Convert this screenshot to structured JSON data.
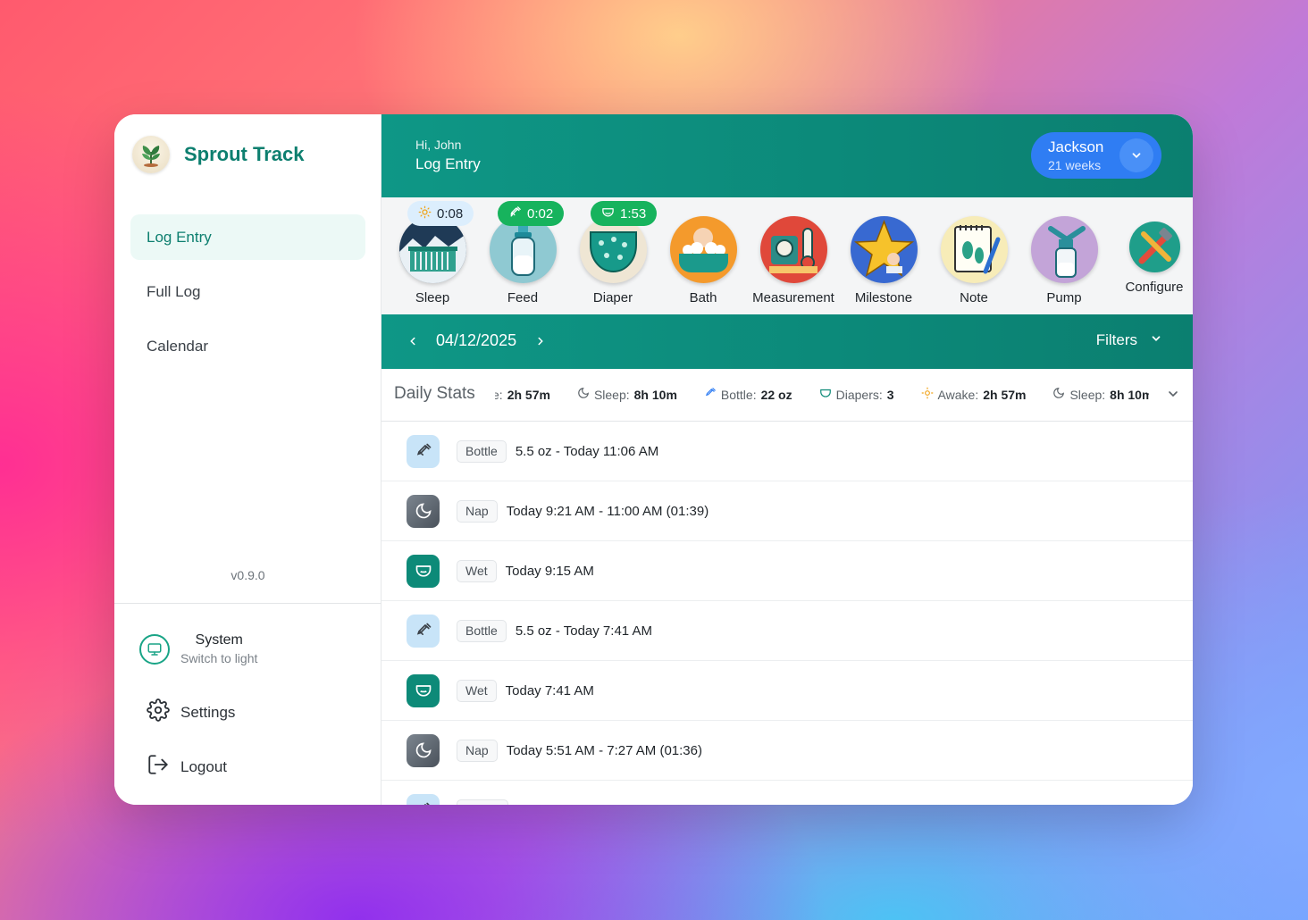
{
  "app": {
    "name": "Sprout Track",
    "version": "v0.9.0"
  },
  "nav": {
    "items": [
      {
        "label": "Log Entry",
        "active": true
      },
      {
        "label": "Full Log",
        "active": false
      },
      {
        "label": "Calendar",
        "active": false
      }
    ]
  },
  "theme": {
    "title": "System",
    "subtitle": "Switch to light",
    "icon": "monitor-icon"
  },
  "sidebar_links": {
    "settings": "Settings",
    "logout": "Logout"
  },
  "header": {
    "greeting": "Hi, John",
    "title": "Log Entry"
  },
  "child": {
    "name": "Jackson",
    "age": "21 weeks"
  },
  "timers": {
    "sleep": "0:08",
    "feed": "0:02",
    "diaper": "1:53"
  },
  "actions": [
    {
      "label": "Sleep",
      "icon": "sleep-crib-icon"
    },
    {
      "label": "Feed",
      "icon": "baby-bottle-icon"
    },
    {
      "label": "Diaper",
      "icon": "diaper-icon"
    },
    {
      "label": "Bath",
      "icon": "bathtub-icon"
    },
    {
      "label": "Measurement",
      "icon": "scale-icon"
    },
    {
      "label": "Milestone",
      "icon": "star-baby-icon"
    },
    {
      "label": "Note",
      "icon": "notepad-footprints-icon"
    },
    {
      "label": "Pump",
      "icon": "breast-pump-icon"
    },
    {
      "label": "Configure",
      "icon": "tools-icon"
    }
  ],
  "datebar": {
    "date": "04/12/2025",
    "filters_label": "Filters"
  },
  "daily_stats": {
    "title": "Daily Stats",
    "items": [
      {
        "label": "ke:",
        "value": "2h 57m",
        "icon": "none"
      },
      {
        "label": "Sleep:",
        "value": "8h 10m",
        "icon": "moon-icon"
      },
      {
        "label": "Bottle:",
        "value": "22 oz",
        "icon": "bottle-icon"
      },
      {
        "label": "Diapers:",
        "value": "3",
        "icon": "diaper-icon"
      },
      {
        "label": "Awake:",
        "value": "2h 57m",
        "icon": "sun-icon"
      },
      {
        "label": "Sleep:",
        "value": "8h 10m",
        "icon": "moon-icon"
      }
    ]
  },
  "entries": [
    {
      "type": "bottle",
      "tag": "Bottle",
      "text": "5.5 oz - Today 11:06 AM"
    },
    {
      "type": "nap",
      "tag": "Nap",
      "text": "Today 9:21 AM - 11:00 AM (01:39)"
    },
    {
      "type": "diaper",
      "tag": "Wet",
      "text": "Today 9:15 AM"
    },
    {
      "type": "bottle",
      "tag": "Bottle",
      "text": "5.5 oz - Today 7:41 AM"
    },
    {
      "type": "diaper",
      "tag": "Wet",
      "text": "Today 7:41 AM"
    },
    {
      "type": "nap",
      "tag": "Nap",
      "text": "Today 5:51 AM - 7:27 AM (01:36)"
    },
    {
      "type": "bottle",
      "tag": "",
      "text": ""
    }
  ],
  "colors": {
    "primary": "#0e9786",
    "accent_blue": "#2f7df3",
    "timer_green": "#17b35d"
  }
}
